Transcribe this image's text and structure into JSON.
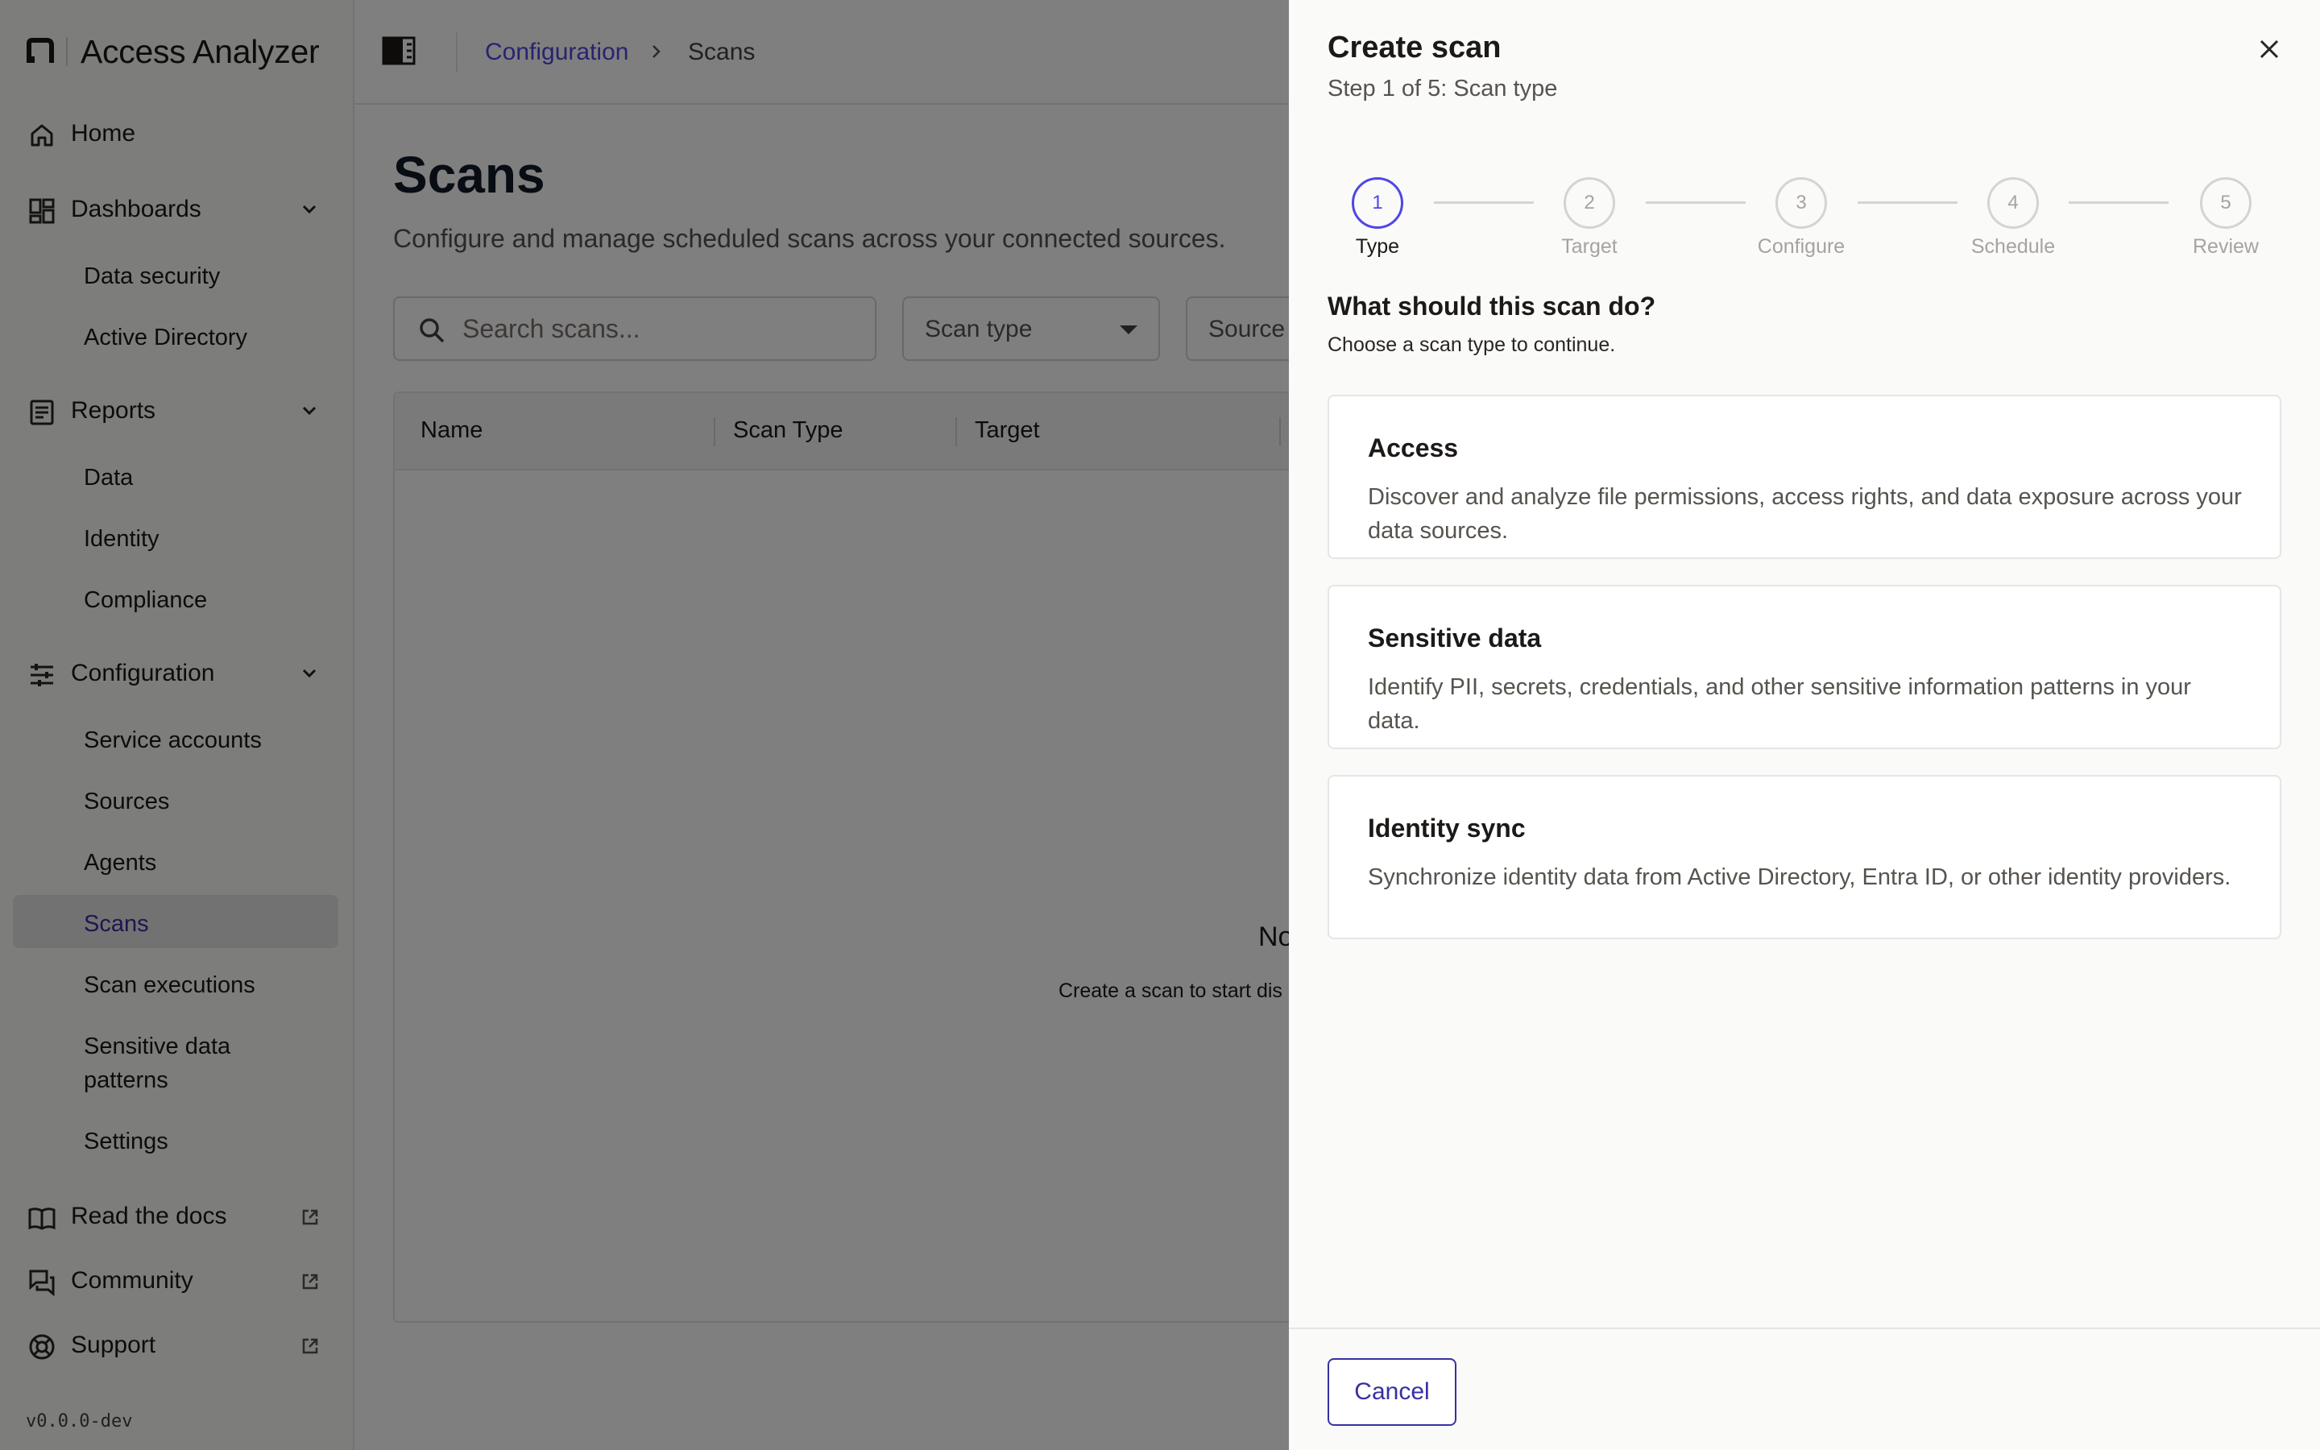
{
  "app": {
    "name": "Access Analyzer",
    "version": "v0.0.0-dev"
  },
  "sidebar": {
    "home": "Home",
    "dashboards": {
      "label": "Dashboards",
      "items": [
        "Data security",
        "Active Directory"
      ]
    },
    "reports": {
      "label": "Reports",
      "items": [
        "Data",
        "Identity",
        "Compliance"
      ]
    },
    "configuration": {
      "label": "Configuration",
      "items": [
        "Service accounts",
        "Sources",
        "Agents",
        "Scans",
        "Scan executions",
        "Sensitive data patterns",
        "Settings"
      ],
      "active": "Scans"
    },
    "links": [
      "Read the docs",
      "Community",
      "Support"
    ]
  },
  "breadcrumb": {
    "parent": "Configuration",
    "current": "Scans"
  },
  "page": {
    "title": "Scans",
    "subtitle": "Configure and manage scheduled scans across your connected sources.",
    "search_placeholder": "Search scans...",
    "filters": [
      "Scan type",
      "Source"
    ],
    "columns": [
      "Name",
      "Scan Type",
      "Target"
    ],
    "empty_title": "No",
    "empty_desc": "Create a scan to start dis"
  },
  "drawer": {
    "title": "Create scan",
    "subtitle": "Step 1 of 5: Scan type",
    "steps": [
      {
        "num": "1",
        "label": "Type"
      },
      {
        "num": "2",
        "label": "Target"
      },
      {
        "num": "3",
        "label": "Configure"
      },
      {
        "num": "4",
        "label": "Schedule"
      },
      {
        "num": "5",
        "label": "Review"
      }
    ],
    "active_step": 1,
    "question": "What should this scan do?",
    "question_hint": "Choose a scan type to continue.",
    "options": [
      {
        "title": "Access",
        "desc": "Discover and analyze file permissions, access rights, and data exposure across your data sources."
      },
      {
        "title": "Sensitive data",
        "desc": "Identify PII, secrets, credentials, and other sensitive information patterns in your data."
      },
      {
        "title": "Identity sync",
        "desc": "Synchronize identity data from Active Directory, Entra ID, or other identity providers."
      }
    ],
    "cancel": "Cancel"
  },
  "colors": {
    "accent": "#4f46e5",
    "accent_dark": "#3730a3",
    "overlay": "rgba(0,0,0,0.5)"
  },
  "icons": [
    "home-icon",
    "dashboards-icon",
    "reports-icon",
    "configuration-icon",
    "docs-icon",
    "community-icon",
    "support-icon",
    "external-link-icon",
    "chevron-down-icon",
    "sidebar-toggle-icon",
    "search-icon",
    "close-icon"
  ]
}
